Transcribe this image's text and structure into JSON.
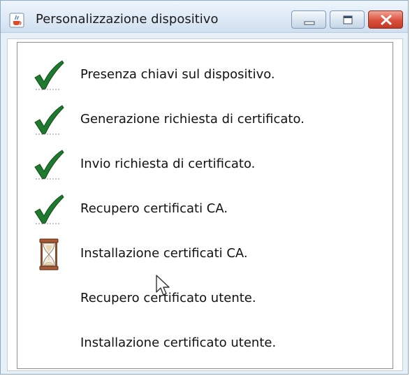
{
  "window": {
    "title": "Personalizzazione dispositivo",
    "icon": "java-cup-icon",
    "controls": [
      "minimize-icon",
      "maximize-icon",
      "close-icon"
    ]
  },
  "steps": [
    {
      "label": "Presenza chiavi sul dispositivo.",
      "status": "done",
      "icon": "checkmark-icon"
    },
    {
      "label": "Generazione richiesta di certificato.",
      "status": "done",
      "icon": "checkmark-icon"
    },
    {
      "label": "Invio richiesta di certificato.",
      "status": "done",
      "icon": "checkmark-icon"
    },
    {
      "label": "Recupero certificati CA.",
      "status": "done",
      "icon": "checkmark-icon"
    },
    {
      "label": "Installazione certificati CA.",
      "status": "in-progress",
      "icon": "hourglass-icon"
    },
    {
      "label": "Recupero certificato utente.",
      "status": "pending",
      "icon": ""
    },
    {
      "label": "Installazione certificato utente.",
      "status": "pending",
      "icon": ""
    }
  ],
  "colors": {
    "check": "#1f7a2e",
    "hourglass_frame": "#8a4a2a",
    "close_button": "#d9503c"
  }
}
